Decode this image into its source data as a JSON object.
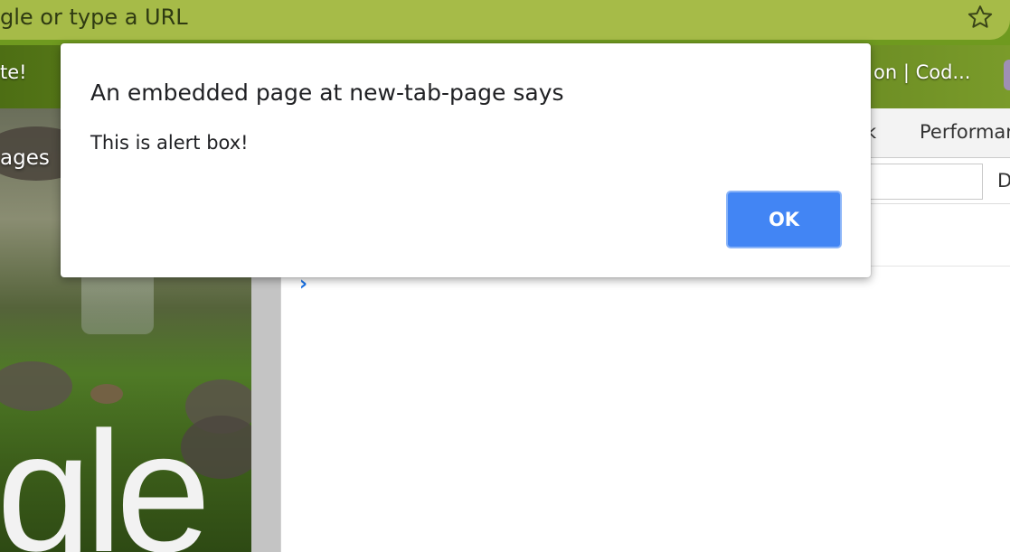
{
  "omnibox": {
    "text": "gle or type a URL",
    "bookmark_icon": "star-icon"
  },
  "bookmarks_bar": {
    "left_item": "te!",
    "right_item": "on | Cod..."
  },
  "background_page": {
    "images_link": "ages",
    "logo_fragment": "gle"
  },
  "devtools": {
    "tab_partial": "k",
    "tab_performance": "Performar",
    "filter_right_label": "D",
    "console_prompt": "›"
  },
  "dialog": {
    "title": "An embedded page at new-tab-page says",
    "message": "This is alert box!",
    "ok_label": "OK"
  },
  "colors": {
    "accent": "#4285f4",
    "theme_green": "#a6bb48"
  }
}
